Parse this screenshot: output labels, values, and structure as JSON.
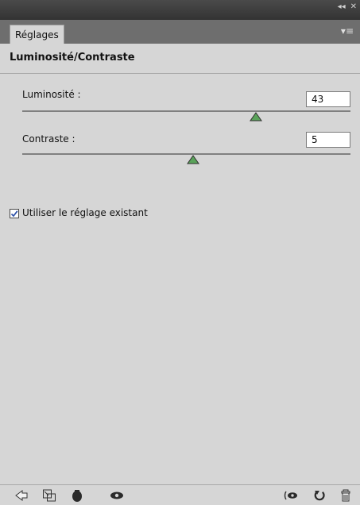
{
  "panel": {
    "tab_label": "Réglages",
    "title": "Luminosité/Contraste"
  },
  "controls": {
    "brightness": {
      "label": "Luminosité :",
      "value": "43",
      "slider_value": 43,
      "min": -150,
      "max": 150
    },
    "contrast": {
      "label": "Contraste :",
      "value": "5",
      "slider_value": 5,
      "min": -50,
      "max": 100
    }
  },
  "use_existing": {
    "label": "Utiliser le réglage existant",
    "checked": true
  },
  "colors": {
    "window_bg": "#d6d6d6",
    "top_chrome": "#3b3b3b",
    "tab_row": "#6e6e6e",
    "thumb_fill": "#5aa35a"
  },
  "icons": [
    "collapse-arrow-icon",
    "close-icon",
    "panel-menu-icon",
    "back-arrow-icon",
    "clip-to-layer-icon",
    "adjustment-layer-icon",
    "visibility-eye-icon",
    "view-previous-state-icon",
    "reset-icon",
    "trash-icon"
  ]
}
